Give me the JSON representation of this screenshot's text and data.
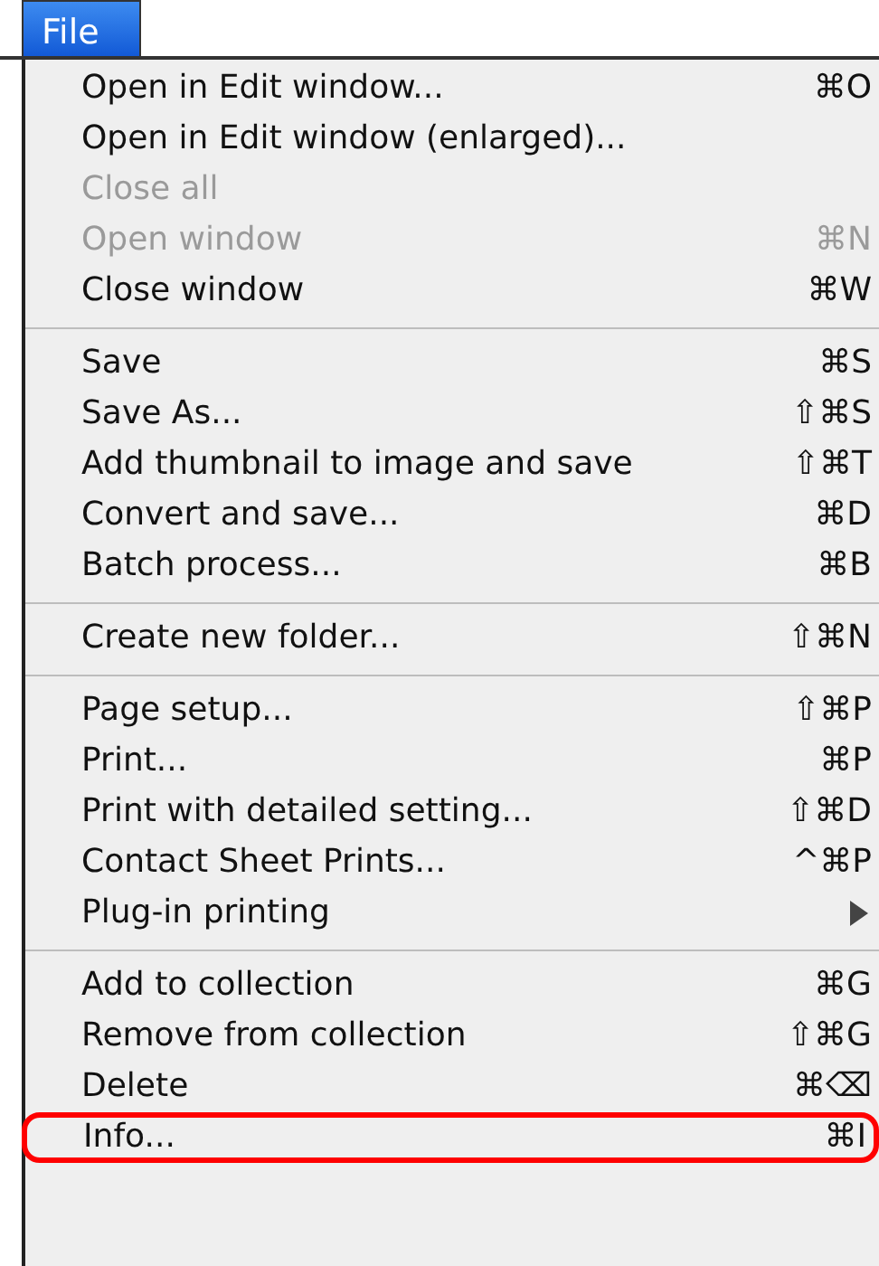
{
  "menu_title": "File",
  "groups": [
    [
      {
        "label": "Open in Edit window...",
        "shortcut": "⌘O",
        "disabled": false,
        "submenu": false,
        "circled": false
      },
      {
        "label": "Open in Edit window (enlarged)...",
        "disabled": false,
        "submenu": false,
        "circled": false
      },
      {
        "label": "Close all",
        "disabled": true,
        "submenu": false,
        "circled": false
      },
      {
        "label": "Open window",
        "shortcut": "⌘N",
        "disabled": true,
        "submenu": false,
        "circled": false
      },
      {
        "label": "Close window",
        "shortcut": "⌘W",
        "disabled": false,
        "submenu": false,
        "circled": false
      }
    ],
    [
      {
        "label": "Save",
        "shortcut": "⌘S",
        "disabled": false,
        "submenu": false,
        "circled": false
      },
      {
        "label": "Save As...",
        "shortcut": "⇧⌘S",
        "disabled": false,
        "submenu": false,
        "circled": false
      },
      {
        "label": "Add thumbnail to image and save",
        "shortcut": "⇧⌘T",
        "disabled": false,
        "submenu": false,
        "circled": false
      },
      {
        "label": "Convert and save...",
        "shortcut": "⌘D",
        "disabled": false,
        "submenu": false,
        "circled": false
      },
      {
        "label": "Batch process...",
        "shortcut": "⌘B",
        "disabled": false,
        "submenu": false,
        "circled": false
      }
    ],
    [
      {
        "label": "Create new folder...",
        "shortcut": "⇧⌘N",
        "disabled": false,
        "submenu": false,
        "circled": false
      }
    ],
    [
      {
        "label": "Page setup...",
        "shortcut": "⇧⌘P",
        "disabled": false,
        "submenu": false,
        "circled": false
      },
      {
        "label": "Print...",
        "shortcut": "⌘P",
        "disabled": false,
        "submenu": false,
        "circled": false
      },
      {
        "label": "Print with detailed setting...",
        "shortcut": "⇧⌘D",
        "disabled": false,
        "submenu": false,
        "circled": false
      },
      {
        "label": "Contact Sheet Prints...",
        "shortcut": "^⌘P",
        "disabled": false,
        "submenu": false,
        "circled": false
      },
      {
        "label": "Plug-in printing",
        "disabled": false,
        "submenu": true,
        "circled": false
      }
    ],
    [
      {
        "label": "Add to collection",
        "shortcut": "⌘G",
        "disabled": false,
        "submenu": false,
        "circled": false
      },
      {
        "label": "Remove from collection",
        "shortcut": "⇧⌘G",
        "disabled": false,
        "submenu": false,
        "circled": false
      },
      {
        "label": "Delete",
        "shortcut": "⌘⌫",
        "disabled": false,
        "submenu": false,
        "circled": false
      },
      {
        "label": "Info...",
        "shortcut": "⌘I",
        "disabled": false,
        "submenu": false,
        "circled": true
      }
    ]
  ]
}
